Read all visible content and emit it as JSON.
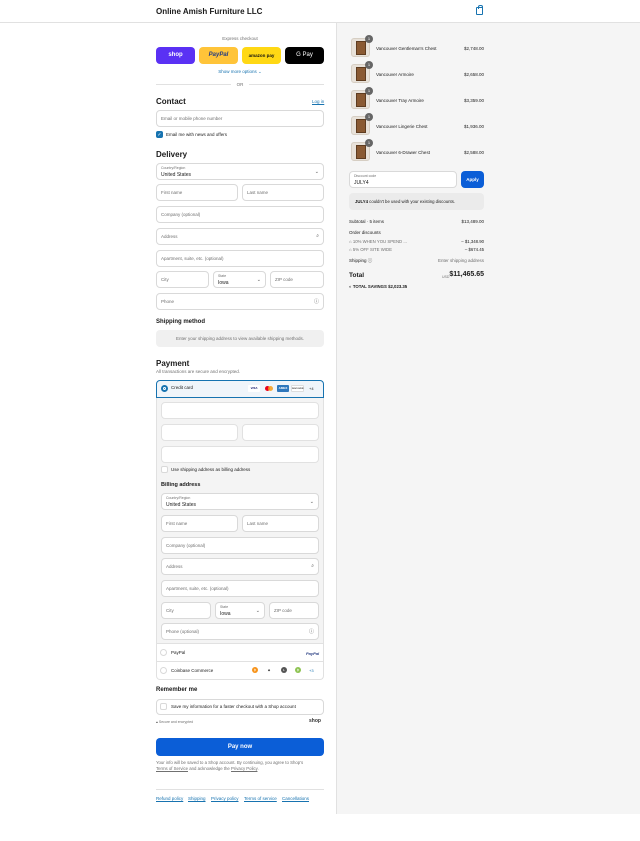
{
  "header": {
    "store_name": "Online Amish Furniture LLC",
    "cart_icon": "bag-icon"
  },
  "express": {
    "title": "Express checkout",
    "buttons": {
      "shop": "shop",
      "paypal": "PayPal",
      "amazon": "amazon pay",
      "gpay": "G Pay"
    },
    "more": "Show more options",
    "or": "OR"
  },
  "contact": {
    "title": "Contact",
    "login": "Log in",
    "email_placeholder": "Email or mobile phone number",
    "newsletter": "Email me with news and offers"
  },
  "delivery": {
    "title": "Delivery",
    "country_label": "Country/Region",
    "country_value": "United States",
    "first_name": "First name",
    "last_name": "Last name",
    "company": "Company (optional)",
    "address": "Address",
    "apartment": "Apartment, suite, etc. (optional)",
    "city": "City",
    "state_label": "State",
    "state_value": "Iowa",
    "zip": "ZIP code",
    "phone": "Phone"
  },
  "shipping_method": {
    "title": "Shipping method",
    "message": "Enter your shipping address to view available shipping methods."
  },
  "payment": {
    "title": "Payment",
    "subtitle": "All transactions are secure and encrypted.",
    "credit_card": "Credit card",
    "card_brands": {
      "visa": "VISA",
      "amex": "AMEX",
      "discover": "DISCOVER",
      "more": "+4"
    },
    "use_shipping": "Use shipping address as billing address",
    "paypal": "PayPal",
    "paypal_logo": "PayPal",
    "coinbase": "Coinbase Commerce",
    "coinbase_more": "+3"
  },
  "billing": {
    "title": "Billing address",
    "country_label": "Country/Region",
    "country_value": "United States",
    "first_name": "First name",
    "last_name": "Last name",
    "company": "Company (optional)",
    "address": "Address",
    "apartment": "Apartment, suite, etc. (optional)",
    "city": "City",
    "state_label": "State",
    "state_value": "Iowa",
    "zip": "ZIP code",
    "phone": "Phone (optional)"
  },
  "remember": {
    "title": "Remember me",
    "save": "Save my information for a faster checkout with a Shop account",
    "secure": "Secure and encrypted",
    "shop": "shop"
  },
  "pay_now": "Pay now",
  "legal": {
    "text1": "Your info will be saved to a Shop account. By continuing, you agree to Shop’s",
    "terms": "Terms of Service",
    "text2": "and acknowledge the",
    "privacy": "Privacy Policy",
    "period": "."
  },
  "footer": {
    "refund": "Refund policy",
    "shipping": "Shipping",
    "privacy": "Privacy policy",
    "terms": "Terms of service",
    "cancellations": "Cancellations"
  },
  "order": {
    "items": [
      {
        "name": "Vancouver Gentleman's Chest",
        "price": "$2,748.00",
        "qty": "1"
      },
      {
        "name": "Vancouver Armoire",
        "price": "$2,658.00",
        "qty": "1"
      },
      {
        "name": "Vancouver Tray Armoire",
        "price": "$3,359.00",
        "qty": "1"
      },
      {
        "name": "Vancouver Lingerie Chest",
        "price": "$1,936.00",
        "qty": "1"
      },
      {
        "name": "Vancouver 6-Drawer Chest",
        "price": "$2,588.00",
        "qty": "1"
      }
    ],
    "discount_label": "Discount code",
    "discount_value": "JULY4",
    "apply": "Apply",
    "error_code": "JULY4",
    "error_text": " couldn't be used with your existing discounts.",
    "subtotal_label": "Subtotal · 5 items",
    "subtotal": "$13,489.00",
    "order_discounts": "Order discounts",
    "discount1_name": "10% WHEN YOU SPEND ...",
    "discount1_value": "– $1,348.90",
    "discount2_name": "5% OFF SITE WIDE",
    "discount2_value": "– $674.45",
    "shipping_label": "Shipping",
    "shipping_value": "Enter shipping address",
    "total_label": "Total",
    "currency": "USD",
    "total": "$11,465.65",
    "savings_label": "TOTAL SAVINGS",
    "savings": "$2,023.35"
  },
  "colors": {
    "accent": "#1773b0",
    "pay_button": "#0b5ed7",
    "shop": "#5a31f4",
    "paypal": "#ffc439",
    "amazon": "#ffd814"
  }
}
